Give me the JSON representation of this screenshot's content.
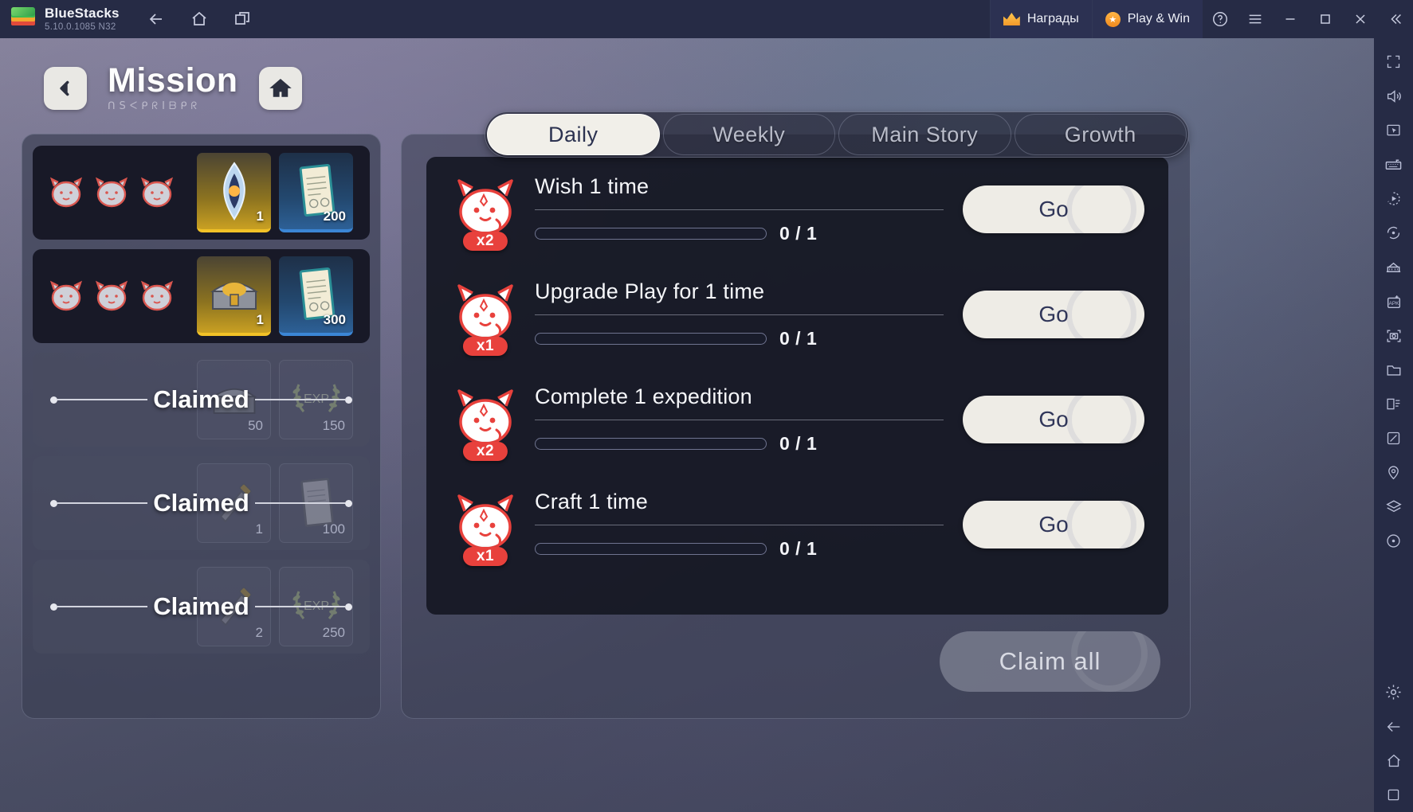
{
  "titlebar": {
    "app_name": "BlueStacks",
    "version": "5.10.0.1085  N32",
    "nav": [
      {
        "name": "back-button",
        "icon": "arrow-left-icon"
      },
      {
        "name": "home-button",
        "icon": "home-icon"
      },
      {
        "name": "multi-instance-button",
        "icon": "windows-icon"
      }
    ],
    "promos": [
      {
        "label": "Награды",
        "icon": "crown-icon"
      },
      {
        "label": "Play & Win",
        "icon": "star-badge-icon"
      }
    ],
    "window_controls": [
      {
        "name": "help-button",
        "icon": "question-circle-icon"
      },
      {
        "name": "menu-button",
        "icon": "hamburger-icon"
      },
      {
        "name": "minimize-button",
        "icon": "minimize-icon"
      },
      {
        "name": "maximize-button",
        "icon": "maximize-icon"
      },
      {
        "name": "close-button",
        "icon": "close-icon"
      },
      {
        "name": "collapse-sidebar-button",
        "icon": "chevron-double-left-icon"
      }
    ]
  },
  "sidebar": {
    "items": [
      "fullscreen-icon",
      "volume-icon",
      "pointer-mode-icon",
      "keyboard-controls-icon",
      "macro-record-icon",
      "rotate-icon",
      "multi-instance-manager-icon",
      "install-apk-icon",
      "screenshot-icon",
      "media-folder-icon",
      "layout-icon",
      "eco-mode-icon",
      "location-icon",
      "layers-icon",
      "shake-icon"
    ],
    "bottom_items": [
      "settings-icon",
      "back-icon",
      "home-icon",
      "recents-icon"
    ]
  },
  "game": {
    "header": {
      "back_button": "back-arrow-icon",
      "title": "Mission",
      "subtitle": "ᑎSᐸᑭᖇIᗷᑭᖇ",
      "home_button": "home-icon"
    },
    "tabs": [
      {
        "label": "Daily",
        "active": true
      },
      {
        "label": "Weekly",
        "active": false
      },
      {
        "label": "Main Story",
        "active": false
      },
      {
        "label": "Growth",
        "active": false
      }
    ],
    "reward_rows": [
      {
        "state": "active",
        "tokens": 3,
        "rewards": [
          {
            "type": "gem",
            "rarity": "gold",
            "qty": "1"
          },
          {
            "type": "scroll",
            "rarity": "blue",
            "qty": "200"
          }
        ]
      },
      {
        "state": "active",
        "tokens": 3,
        "rewards": [
          {
            "type": "chest",
            "rarity": "gold",
            "qty": "1"
          },
          {
            "type": "scroll",
            "rarity": "blue",
            "qty": "300"
          }
        ]
      },
      {
        "state": "claimed",
        "label": "Claimed",
        "tokens": 0,
        "rewards": [
          {
            "type": "chest",
            "rarity": "dim",
            "qty": "50"
          },
          {
            "type": "exp",
            "rarity": "dim",
            "qty": "150"
          }
        ]
      },
      {
        "state": "claimed",
        "label": "Claimed",
        "tokens": 0,
        "rewards": [
          {
            "type": "item",
            "rarity": "dim",
            "qty": "1"
          },
          {
            "type": "scroll",
            "rarity": "dim",
            "qty": "100"
          }
        ]
      },
      {
        "state": "claimed",
        "label": "Claimed",
        "tokens": 0,
        "rewards": [
          {
            "type": "item",
            "rarity": "dim",
            "qty": "2"
          },
          {
            "type": "exp",
            "rarity": "dim",
            "qty": "250"
          }
        ]
      }
    ],
    "missions": [
      {
        "title": "Wish 1 time",
        "multiplier": "x2",
        "progress": "0 / 1",
        "percent": 0,
        "action": "Go"
      },
      {
        "title": "Upgrade Play for 1 time",
        "multiplier": "x1",
        "progress": "0 / 1",
        "percent": 0,
        "action": "Go"
      },
      {
        "title": "Complete 1 expedition",
        "multiplier": "x2",
        "progress": "0 / 1",
        "percent": 0,
        "action": "Go"
      },
      {
        "title": "Craft 1 time",
        "multiplier": "x1",
        "progress": "0 / 1",
        "percent": 0,
        "action": "Go"
      }
    ],
    "claim_all": {
      "label": "Claim  all",
      "enabled": false
    }
  },
  "colors": {
    "titlebar_bg": "#262b45",
    "accent_orange": "#f08a1e",
    "badge_red": "#e8413c",
    "button_cream": "#eeece6",
    "button_text": "#303659",
    "gold": "#f2c227",
    "blue": "#3b86d6"
  }
}
